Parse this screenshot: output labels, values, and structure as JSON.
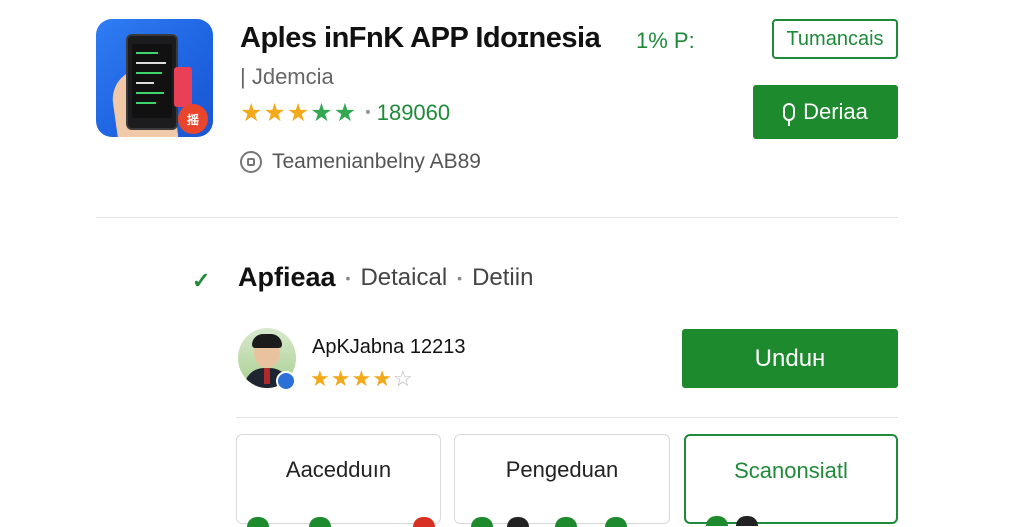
{
  "app": {
    "title": "Aples inFnK APP Idoɪnesia",
    "meta": "1% P:",
    "subtitle": "| Jdemcia",
    "rating_count": "189060",
    "developer": "Teamenianbelny AB89",
    "icon_badge": "摇"
  },
  "header_buttons": {
    "outline_label": "Tumancais",
    "primary_label": "Deriaa"
  },
  "breadcrumb": {
    "main": "Apfieaa",
    "items": [
      "Detaical",
      "Detiin"
    ]
  },
  "review": {
    "reviewer_name": "ApKJabna 12213",
    "stars_filled": 4,
    "stars_total": 5
  },
  "download_button": {
    "label": "Unduн"
  },
  "tabs": [
    {
      "label": "Aacedduın"
    },
    {
      "label": "Pengeduan"
    },
    {
      "label": "Scanonsiatl"
    }
  ],
  "colors": {
    "accent_green": "#1e8a2e",
    "star_yellow": "#f2a91a",
    "star_green": "#32a853"
  }
}
